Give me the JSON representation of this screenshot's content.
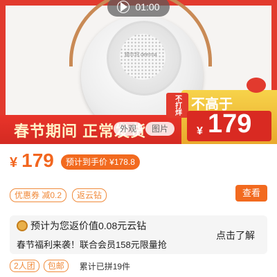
{
  "video": {
    "time": "01:00",
    "icon": "play-icon"
  },
  "hero": {
    "banner_text": "春节期间 正常发货",
    "tags": [
      "外观",
      "图片"
    ],
    "brand_logo": "德尔玛 deerma",
    "promo_stamp": "不打烊",
    "promo_label": "不高于",
    "promo_currency": "¥",
    "promo_price": "179"
  },
  "price": {
    "currency": "¥",
    "value": "179",
    "final_label": "预计到手价 ¥178.8"
  },
  "coupons": {
    "items": [
      "优惠券 减0.2",
      "返云钻"
    ],
    "view_button": "查看"
  },
  "cashback": {
    "icon": "coin-icon",
    "line1": "预计为您返价值0.08元云钻",
    "line2": "春节福利来袭！联合会员158元限量抢",
    "action": "点击了解"
  },
  "group": {
    "tags": [
      "2人团",
      "包邮"
    ],
    "text": "累计已拼19件"
  },
  "colors": {
    "accent": "#f26a1f",
    "banner_red": "#e23a2e",
    "promo_yellow": "#f7d34a"
  }
}
